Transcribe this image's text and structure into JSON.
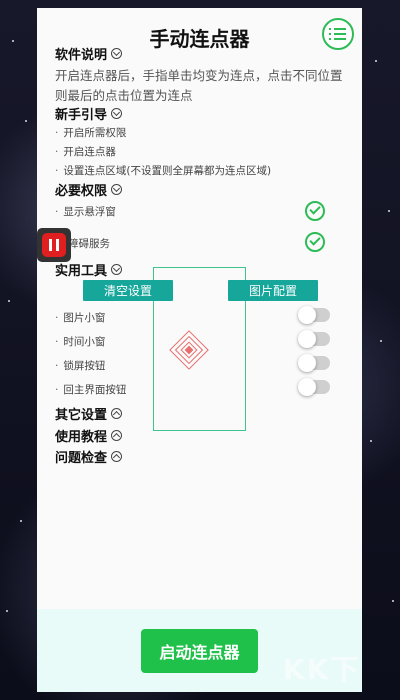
{
  "title": "手动连点器",
  "sections": {
    "software": "软件说明",
    "guide": "新手引导",
    "permissions": "必要权限",
    "tools": "实用工具",
    "other": "其它设置",
    "tutorial": "使用教程",
    "issues": "问题检查"
  },
  "description": "开启连点器后，手指单击均变为连点，点击不同位置则最后的点击位置为连点",
  "guide_items": [
    "开启所需权限",
    "开启连点器",
    "设置连点区域(不设置则全屏幕都为连点区域)"
  ],
  "permission_items": [
    "显示悬浮窗",
    "障碍服务"
  ],
  "tool_buttons": {
    "clear": "清空设置",
    "image": "图片配置"
  },
  "tool_items": [
    "图片小窗",
    "时间小窗",
    "锁屏按钮",
    "回主界面按钮"
  ],
  "toggles": {
    "image_window": false,
    "time_window": false,
    "lock_button": false,
    "home_button": false
  },
  "start_button": "启动连点器",
  "watermark": "KK下",
  "colors": {
    "accent_green": "#20c14a",
    "teal": "#16a69a",
    "check_green": "#2dbb56",
    "target_red": "#e86e6e"
  }
}
